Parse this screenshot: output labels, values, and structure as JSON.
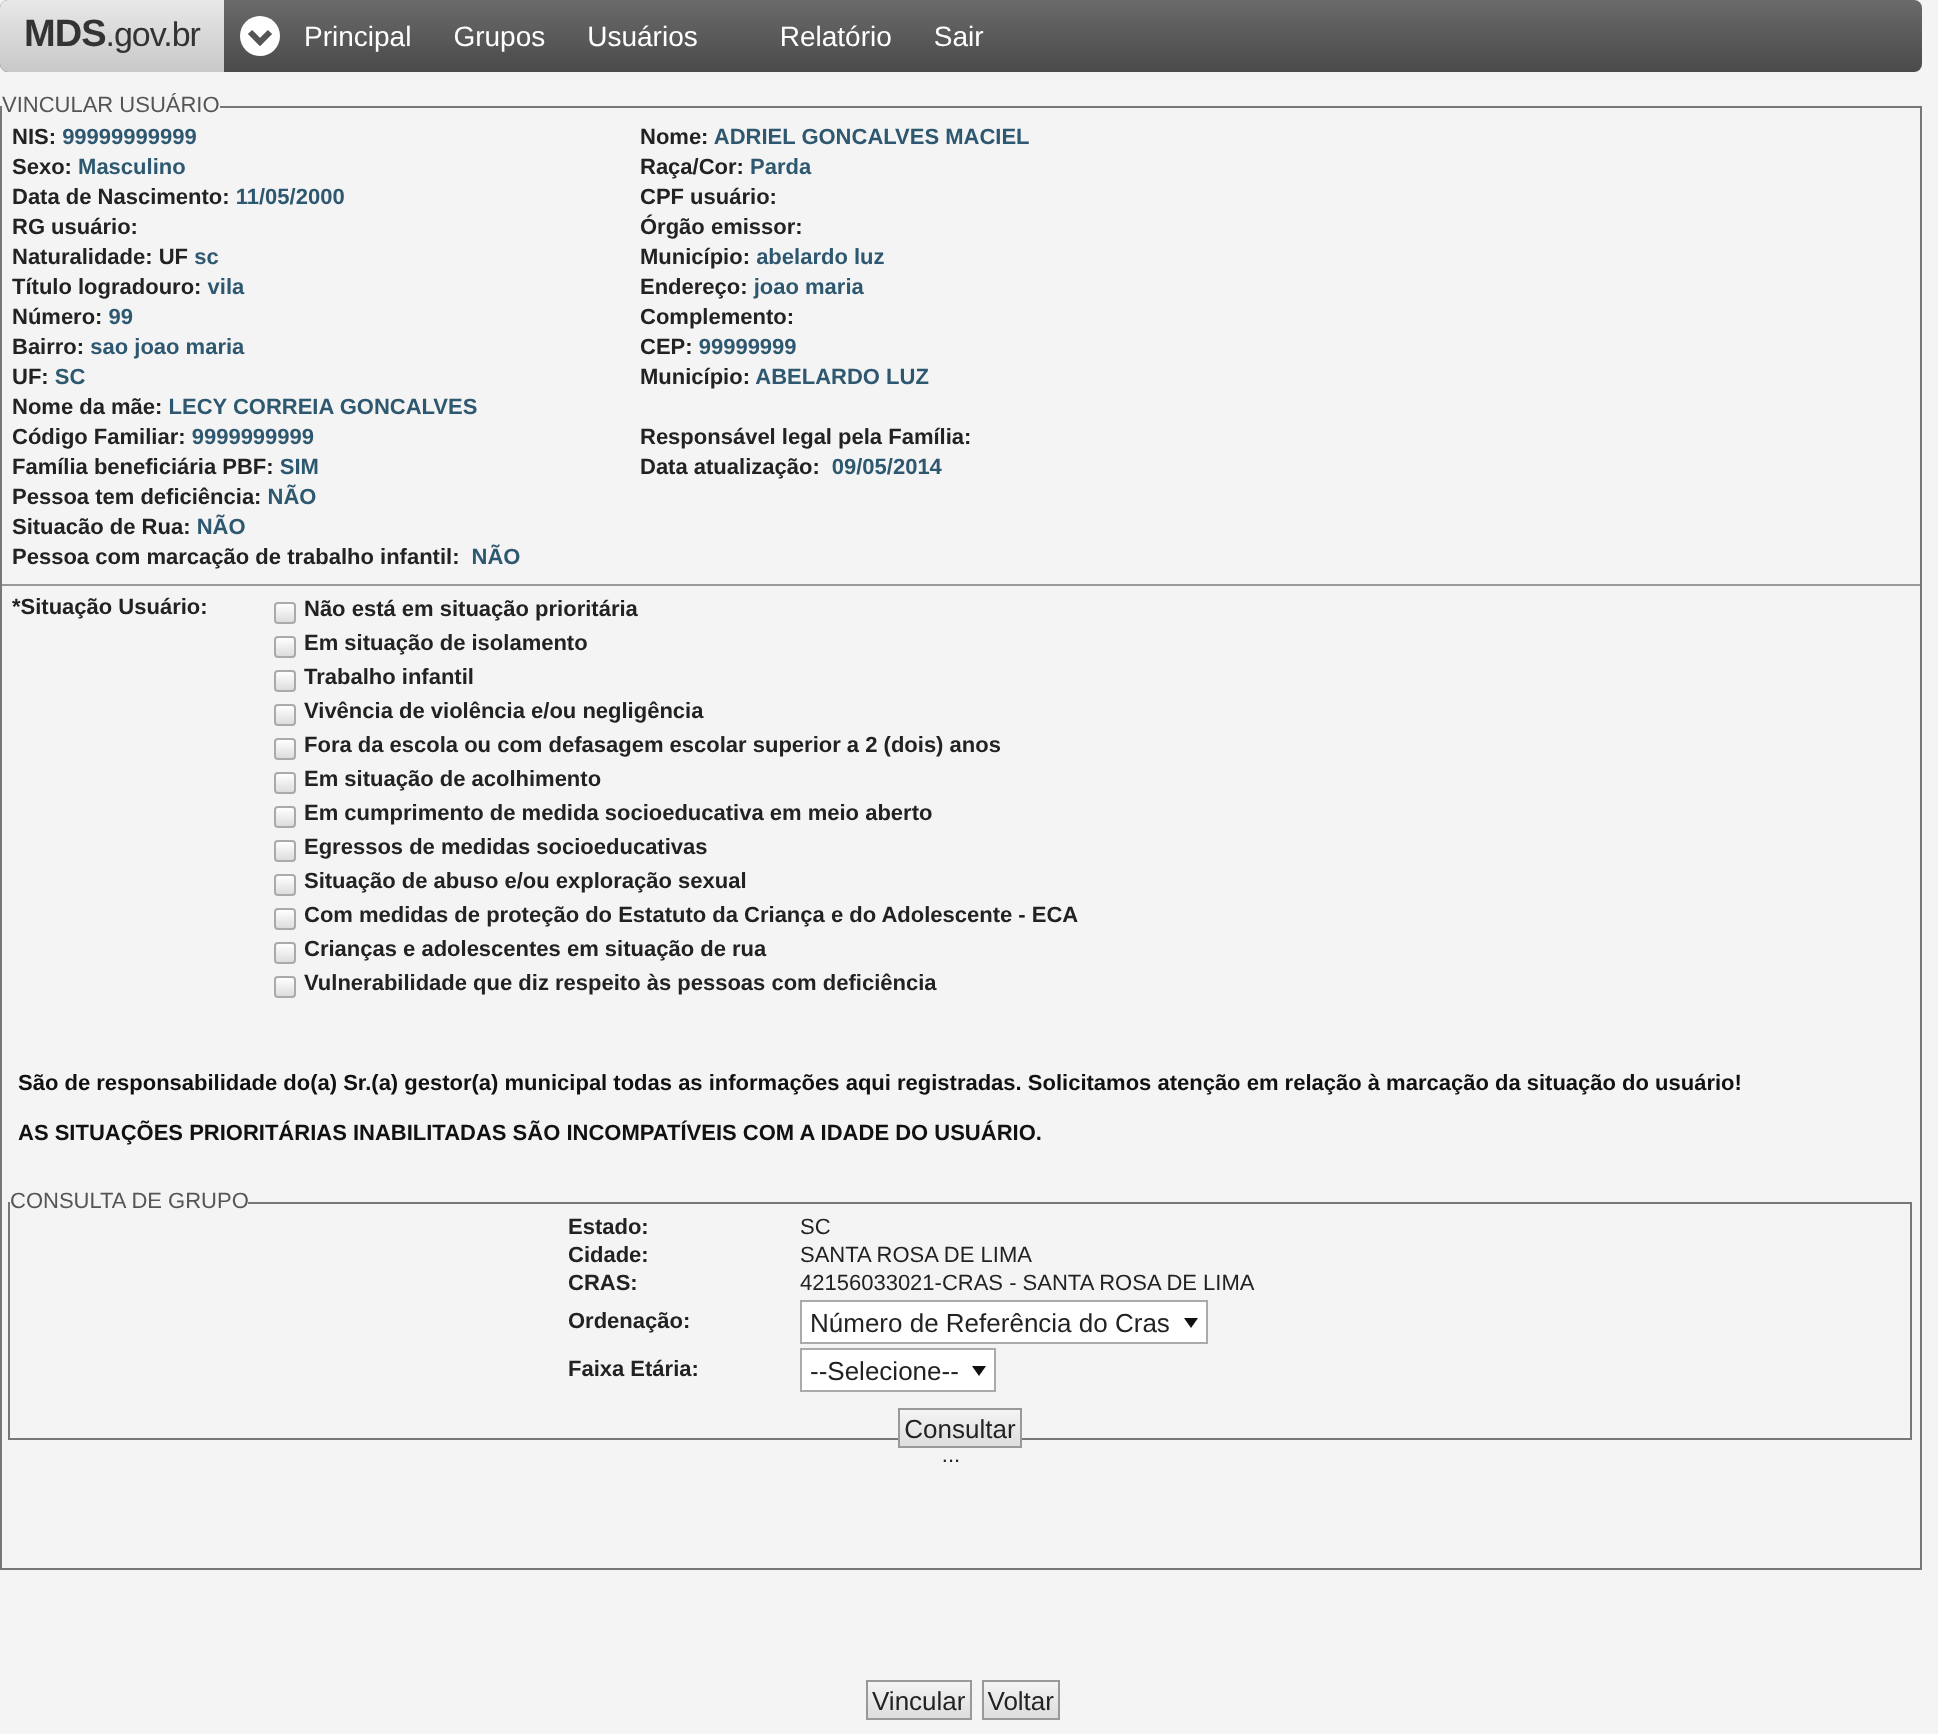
{
  "header": {
    "logo_bold": "MDS",
    "logo_rest": ".gov.br",
    "menu": [
      "Principal",
      "Grupos",
      "Usuários",
      "Relatório",
      "Sair"
    ]
  },
  "vincular": {
    "legend": "VINCULAR USUÁRIO",
    "rows": [
      {
        "left": {
          "label": "NIS:",
          "value": "99999999999"
        },
        "right": {
          "label": "Nome:",
          "value": "ADRIEL GONCALVES MACIEL"
        }
      },
      {
        "left": {
          "label": "Sexo:",
          "value": "Masculino"
        },
        "right": {
          "label": "Raça/Cor:",
          "value": "Parda"
        }
      },
      {
        "left": {
          "label": "Data de Nascimento:",
          "value": "11/05/2000"
        },
        "right": {
          "label": "CPF usuário:"
        }
      },
      {
        "left": {
          "label": "RG usuário:"
        },
        "right": {
          "label": "Órgão emissor:"
        }
      },
      {
        "left": {
          "label": "Naturalidade: UF",
          "value": "sc"
        },
        "right": {
          "label": "Município:",
          "value": "abelardo luz"
        }
      },
      {
        "left": {
          "label": "Título logradouro:",
          "value": "vila"
        },
        "right": {
          "label": "Endereço:",
          "value": "joao maria"
        }
      },
      {
        "left": {
          "label": "Número:",
          "value": "99"
        },
        "right": {
          "label": "Complemento:"
        }
      },
      {
        "left": {
          "label": "Bairro:",
          "value": "sao joao maria"
        },
        "right": {
          "label": "CEP:",
          "value": "99999999"
        }
      },
      {
        "left": {
          "label": "UF:",
          "value": "SC"
        },
        "right": {
          "label": "Município:",
          "value": "ABELARDO LUZ"
        }
      },
      {
        "left": {
          "label": "Nome da mãe:",
          "value": "LECY CORREIA GONCALVES"
        }
      },
      {
        "left": {
          "label": "Código Familiar:",
          "value": "9999999999"
        },
        "right": {
          "label": "Responsável legal pela Família:"
        }
      },
      {
        "left": {
          "label": "Família beneficiária PBF:",
          "value": "SIM"
        },
        "right": {
          "label": "Data atualização:",
          "value": "09/05/2014",
          "kind": "inline"
        }
      },
      {
        "left": {
          "label": "Pessoa tem deficiência:",
          "value": "NÃO"
        }
      },
      {
        "left": {
          "label": "Situacão de Rua:",
          "value": "NÃO"
        }
      },
      {
        "left": {
          "label": "Pessoa com marcação de trabalho infantil:",
          "value": "NÃO",
          "kind": "inline"
        }
      }
    ],
    "situacao_label": "*Situação Usuário:",
    "situacoes": [
      {
        "label": "Não está em situação prioritária",
        "checked": false
      },
      {
        "label": "Em situação de isolamento",
        "checked": false
      },
      {
        "label": "Trabalho infantil",
        "checked": false
      },
      {
        "label": "Vivência de violência e/ou negligência",
        "checked": false
      },
      {
        "label": "Fora da escola ou com defasagem escolar superior a 2 (dois) anos",
        "checked": false
      },
      {
        "label": "Em situação de acolhimento",
        "checked": false
      },
      {
        "label": "Em cumprimento de medida socioeducativa em meio aberto",
        "checked": false
      },
      {
        "label": "Egressos de medidas socioeducativas",
        "checked": false
      },
      {
        "label": "Situação de abuso e/ou exploração sexual",
        "checked": false
      },
      {
        "label": "Com medidas de proteção do Estatuto da Criança e do Adolescente - ECA",
        "checked": false
      },
      {
        "label": "Crianças e adolescentes em situação de rua",
        "checked": false
      },
      {
        "label": "Vulnerabilidade que diz respeito às pessoas com deficiência",
        "checked": false
      }
    ],
    "notices": [
      "São de responsabilidade do(a) Sr.(a) gestor(a) municipal todas as informações aqui registradas. Solicitamos atenção em relação à marcação da situação do usuário!",
      "AS SITUAÇÕES PRIORITÁRIAS INABILITADAS SÃO INCOMPATÍVEIS COM A IDADE DO USUÁRIO."
    ],
    "consulta": {
      "legend": "CONSULTA DE GRUPO",
      "fields": [
        {
          "label": "Estado:",
          "value": "SC",
          "kind": "text"
        },
        {
          "label": "Cidade:",
          "value": "SANTA ROSA DE LIMA",
          "kind": "text"
        },
        {
          "label": "CRAS:",
          "value": "42156033021-CRAS - SANTA ROSA DE LIMA",
          "kind": "text"
        },
        {
          "label": "Ordenação:",
          "value": "Número de Referência do Cras",
          "kind": "select"
        },
        {
          "label": "Faixa Etária:",
          "value": "--Selecione--",
          "kind": "select"
        }
      ],
      "button": "Consultar"
    },
    "ellipsis": "..."
  },
  "buttons": [
    "Vincular",
    "Voltar"
  ]
}
